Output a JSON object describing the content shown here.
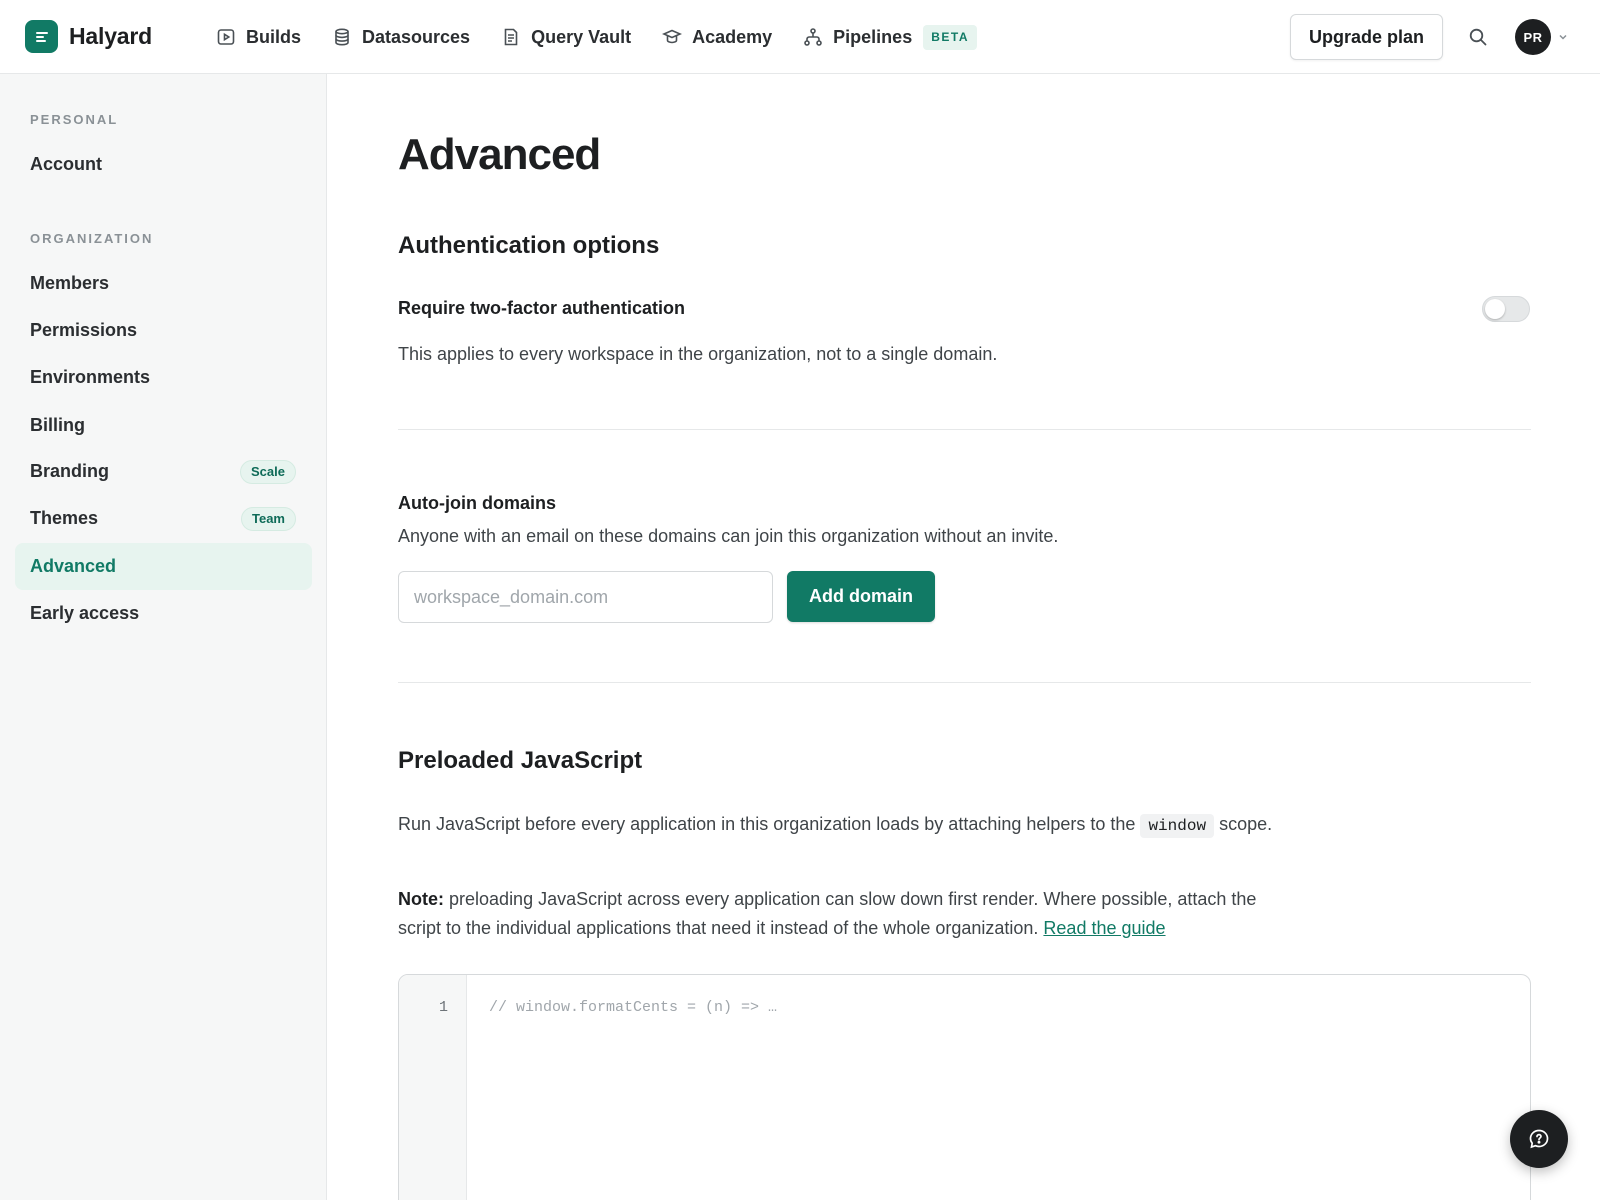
{
  "app": {
    "name": "Halyard",
    "logo_icon": "menu-lines-icon"
  },
  "nav": {
    "items": [
      {
        "label": "Builds",
        "icon": "play-square-icon"
      },
      {
        "label": "Datasources",
        "icon": "database-icon"
      },
      {
        "label": "Query Vault",
        "icon": "document-icon"
      },
      {
        "label": "Academy",
        "icon": "graduation-cap-icon"
      },
      {
        "label": "Pipelines",
        "icon": "workflow-icon",
        "badge": "BETA"
      }
    ],
    "upgrade_label": "Upgrade plan",
    "avatar_initials": "PR"
  },
  "sidebar": {
    "personal_heading": "PERSONAL",
    "personal_items": [
      {
        "label": "Account"
      }
    ],
    "org_heading": "ORGANIZATION",
    "org_items": [
      {
        "label": "Members"
      },
      {
        "label": "Permissions"
      },
      {
        "label": "Environments"
      },
      {
        "label": "Billing"
      },
      {
        "label": "Branding",
        "badge": "Scale"
      },
      {
        "label": "Themes",
        "badge": "Team"
      },
      {
        "label": "Advanced",
        "active": true
      },
      {
        "label": "Early access"
      }
    ]
  },
  "main": {
    "title": "Advanced",
    "auth": {
      "heading": "Authentication options",
      "twofa_label": "Require two-factor authentication",
      "twofa_enabled": false,
      "twofa_desc": "This applies to every workspace in the organization, not to a single domain."
    },
    "autojoin": {
      "heading": "Auto-join domains",
      "desc": "Anyone with an email on these domains can join this organization without an invite.",
      "input_value": "",
      "input_placeholder": "workspace_domain.com",
      "add_label": "Add domain"
    },
    "preload": {
      "heading": "Preloaded JavaScript",
      "desc_before": "Run JavaScript before every application in this organization loads by attaching helpers to the",
      "desc_code": "window",
      "desc_after": "scope.",
      "note_label": "Note:",
      "note_text": "preloading JavaScript across every application can slow down first render. Where possible, attach the script to the individual applications that need it instead of the whole organization.",
      "guide_link": "Read the guide",
      "editor_line_number": "1",
      "editor_placeholder": "// window.formatCents = (n) => …"
    }
  },
  "colors": {
    "accent": "#117a65",
    "accent_light": "#e7f4ef",
    "dark": "#1d1f21"
  }
}
